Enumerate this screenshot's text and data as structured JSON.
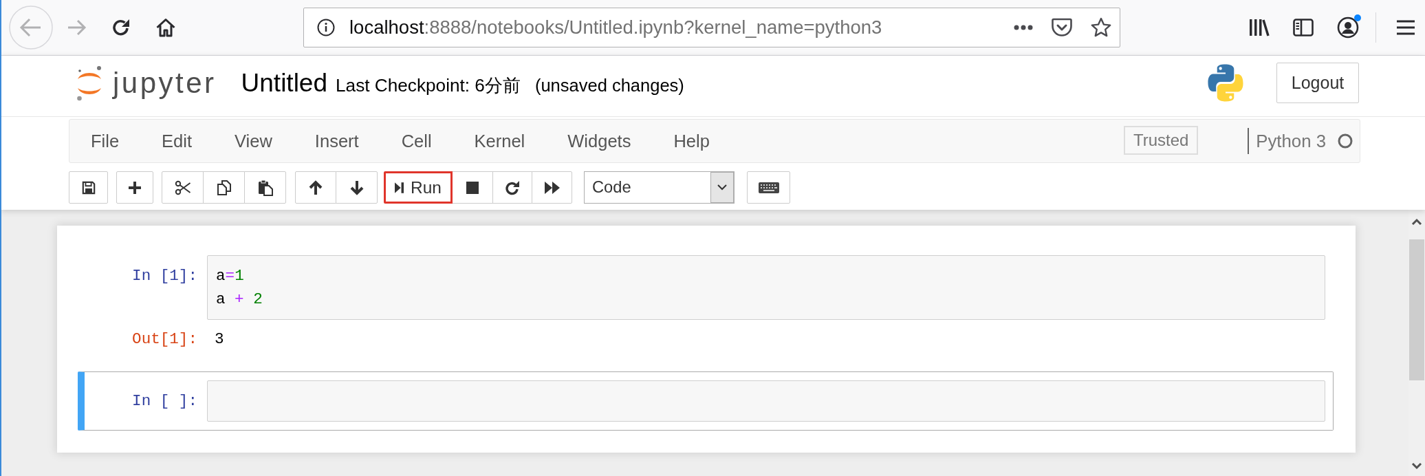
{
  "browser": {
    "back": {
      "disabled": true
    },
    "forward": {
      "disabled": true
    },
    "address": {
      "host": "localhost",
      "path": ":8888/notebooks/Untitled.ipynb?kernel_name=python3"
    },
    "account": {
      "notification": true
    }
  },
  "header": {
    "logo_text": "jupyter",
    "notebook_name": "Untitled",
    "checkpoint": "Last Checkpoint: 6分前",
    "save_status": "(unsaved changes)",
    "logout": "Logout"
  },
  "menubar": {
    "items": [
      "File",
      "Edit",
      "View",
      "Insert",
      "Cell",
      "Kernel",
      "Widgets",
      "Help"
    ],
    "trusted": "Trusted",
    "kernel_name": "Python 3",
    "kernel_busy": false
  },
  "toolbar": {
    "run_button": {
      "label": "Run",
      "highlighted": true
    },
    "cell_type": "Code"
  },
  "cells": [
    {
      "selected": false,
      "prompt": "In [1]:",
      "source": [
        [
          {
            "kind": "name",
            "text": "a"
          },
          {
            "kind": "operator",
            "text": "="
          },
          {
            "kind": "number",
            "text": "1"
          }
        ],
        [
          {
            "kind": "name",
            "text": "a"
          },
          {
            "kind": "operator",
            "text": " + "
          },
          {
            "kind": "number",
            "text": "2"
          }
        ]
      ],
      "output": {
        "prompt": "Out[1]:",
        "text": "3"
      }
    },
    {
      "selected": true,
      "prompt": "In [ ]:"
    }
  ]
}
